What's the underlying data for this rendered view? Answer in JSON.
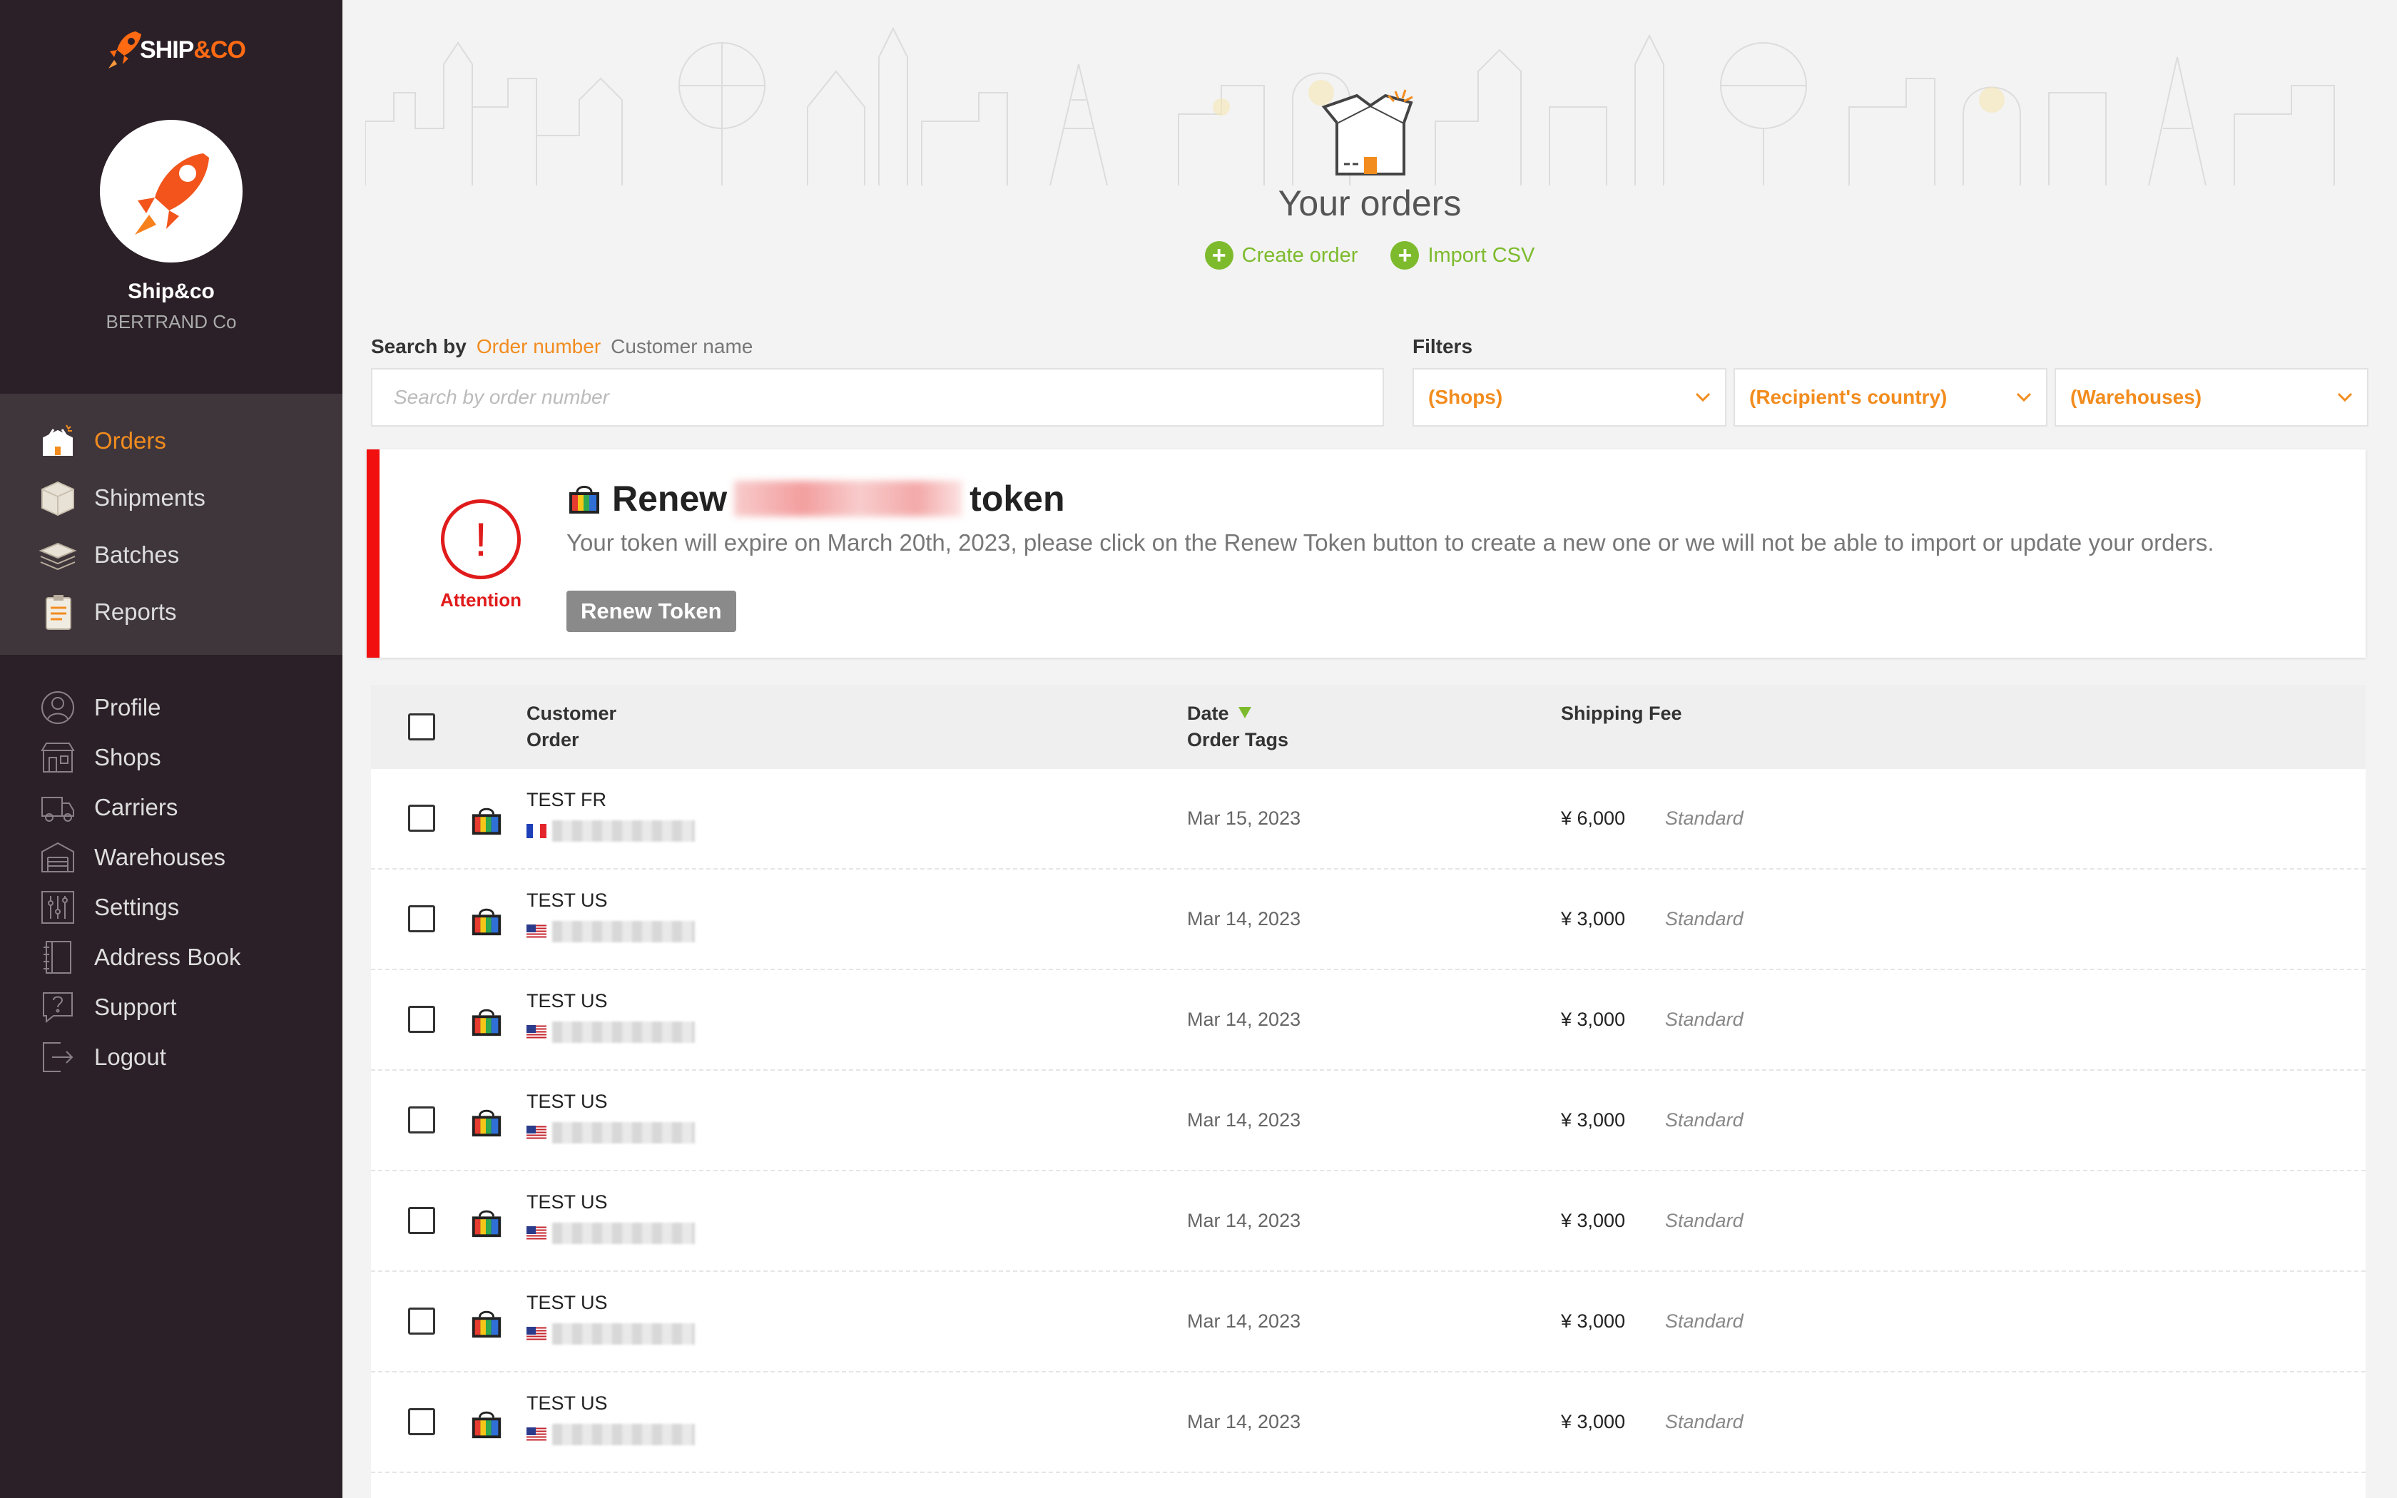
{
  "app": {
    "logo_text_a": "SHIP",
    "logo_text_b": "&CO"
  },
  "account": {
    "name": "Ship&co",
    "company": "BERTRAND Co"
  },
  "nav_main": [
    {
      "label": "Orders",
      "icon": "orders-icon",
      "active": true
    },
    {
      "label": "Shipments",
      "icon": "shipments-icon"
    },
    {
      "label": "Batches",
      "icon": "batches-icon"
    },
    {
      "label": "Reports",
      "icon": "reports-icon"
    }
  ],
  "nav_secondary": [
    {
      "label": "Profile",
      "icon": "profile-icon"
    },
    {
      "label": "Shops",
      "icon": "shops-icon"
    },
    {
      "label": "Carriers",
      "icon": "carriers-icon"
    },
    {
      "label": "Warehouses",
      "icon": "warehouses-icon"
    },
    {
      "label": "Settings",
      "icon": "settings-icon"
    },
    {
      "label": "Address Book",
      "icon": "address-book-icon"
    },
    {
      "label": "Support",
      "icon": "support-icon"
    },
    {
      "label": "Logout",
      "icon": "logout-icon"
    }
  ],
  "hero": {
    "title": "Your orders",
    "create_label": "Create order",
    "import_label": "Import CSV"
  },
  "search": {
    "label": "Search by",
    "mode_active": "Order number",
    "mode_other": "Customer name",
    "placeholder": "Search by order number"
  },
  "filters": {
    "label": "Filters",
    "shops": "(Shops)",
    "country": "(Recipient's country)",
    "warehouses": "(Warehouses)"
  },
  "alert": {
    "badge": "Attention",
    "title_prefix": "Renew",
    "title_suffix": "token",
    "message": "Your token will expire on March 20th, 2023, please click on the Renew Token button to create a new one or we will not be able to import or update your orders.",
    "button": "Renew Token"
  },
  "table": {
    "col_customer": "Customer",
    "col_order": "Order",
    "col_date": "Date",
    "col_tags": "Order Tags",
    "col_fee": "Shipping Fee",
    "rows": [
      {
        "customer": "TEST FR",
        "country": "FR",
        "date": "Mar 15, 2023",
        "fee": "¥ 6,000",
        "service": "Standard"
      },
      {
        "customer": "TEST US",
        "country": "US",
        "date": "Mar 14, 2023",
        "fee": "¥ 3,000",
        "service": "Standard"
      },
      {
        "customer": "TEST US",
        "country": "US",
        "date": "Mar 14, 2023",
        "fee": "¥ 3,000",
        "service": "Standard"
      },
      {
        "customer": "TEST US",
        "country": "US",
        "date": "Mar 14, 2023",
        "fee": "¥ 3,000",
        "service": "Standard"
      },
      {
        "customer": "TEST US",
        "country": "US",
        "date": "Mar 14, 2023",
        "fee": "¥ 3,000",
        "service": "Standard"
      },
      {
        "customer": "TEST US",
        "country": "US",
        "date": "Mar 14, 2023",
        "fee": "¥ 3,000",
        "service": "Standard"
      },
      {
        "customer": "TEST US",
        "country": "US",
        "date": "Mar 14, 2023",
        "fee": "¥ 3,000",
        "service": "Standard"
      }
    ]
  },
  "colors": {
    "accent": "#f28c1e",
    "green": "#7dbb2d",
    "alert_red": "#f10f0f",
    "sidebar": "#2b2027"
  }
}
